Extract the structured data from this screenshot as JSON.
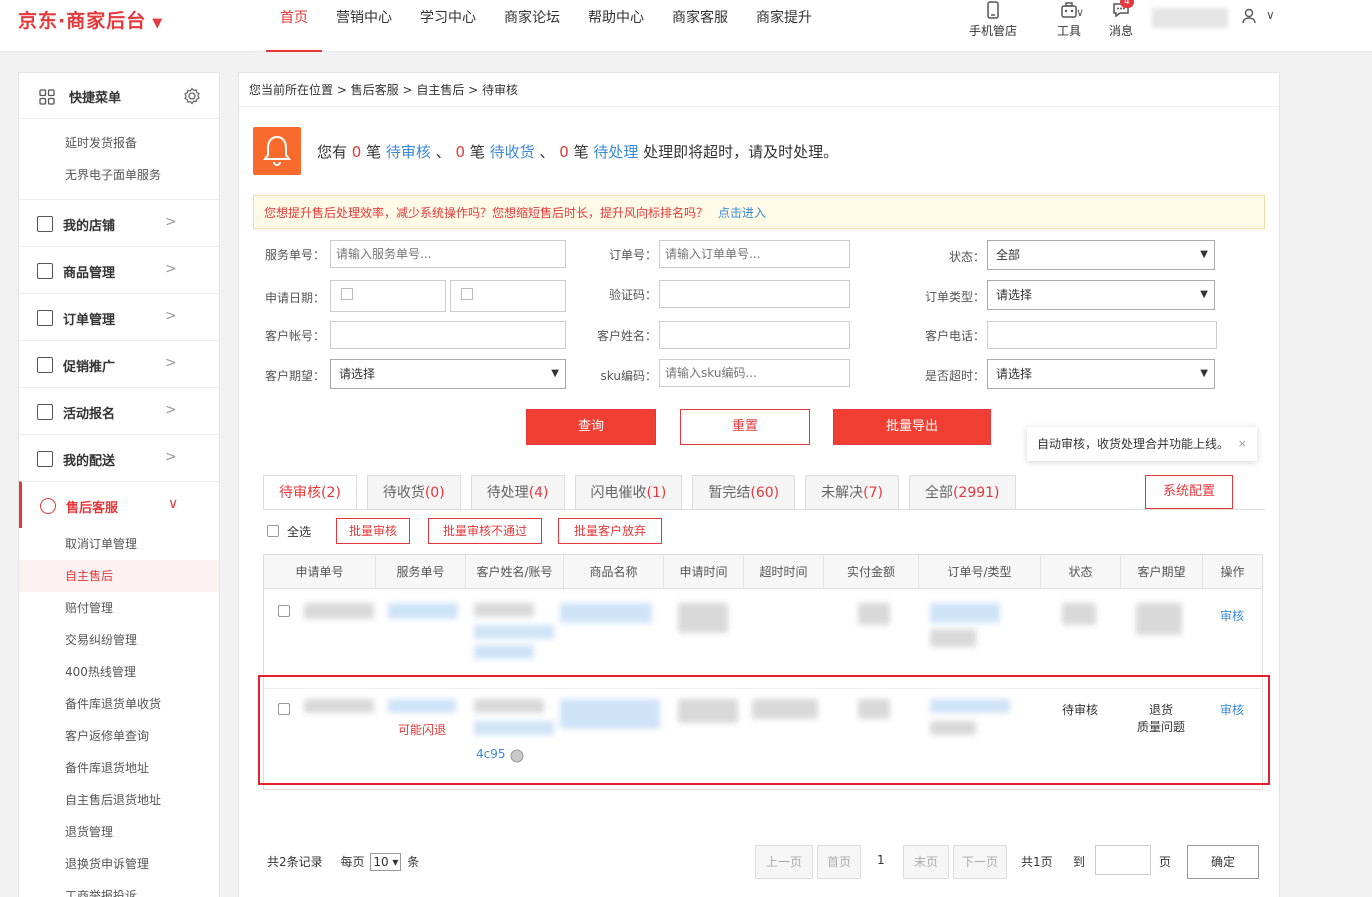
{
  "header": {
    "logo": "京东·商家后台",
    "nav": [
      "首页",
      "营销中心",
      "学习中心",
      "商家论坛",
      "帮助中心",
      "商家客服",
      "商家提升"
    ],
    "tools": {
      "mobile": "手机管店",
      "tools": "工具",
      "messages": "消息",
      "msg_badge": "4"
    }
  },
  "sidebar": {
    "quick_title": "快捷菜单",
    "quick_items": [
      "延时发货报备",
      "无界电子面单服务"
    ],
    "sections": [
      "我的店铺",
      "商品管理",
      "订单管理",
      "促销推广",
      "活动报名",
      "我的配送"
    ],
    "active_section": "售后客服",
    "sub_items": [
      "取消订单管理",
      "自主售后",
      "赔付管理",
      "交易纠纷管理",
      "400热线管理",
      "备件库退货单收货",
      "客户返修单查询",
      "备件库退货地址",
      "自主售后退货地址",
      "退货管理",
      "退换货申诉管理",
      "工商举报投诉"
    ]
  },
  "breadcrumb": "您当前所在位置 > 售后客服 > 自主售后 > 待审核",
  "alert": {
    "pre": "您有",
    "n1": "0",
    "u1": "笔",
    "l1": "待审核",
    "sep1": "、",
    "n2": "0",
    "u2": "笔",
    "l2": "待收货",
    "sep2": "、",
    "n3": "0",
    "u3": "笔",
    "l3": "待处理",
    "post": "处理即将超时，请及时处理。"
  },
  "notice": {
    "text": "您想提升售后处理效率，减少系统操作吗？您想缩短售后时长，提升风向标排名吗？",
    "link": "点击进入"
  },
  "form": {
    "service_no": "服务单号：",
    "service_no_ph": "请输入服务单号...",
    "order_no": "订单号：",
    "order_no_ph": "请输入订单单号...",
    "status": "状态：",
    "status_val": "全部",
    "apply_date": "申请日期：",
    "verify_code": "验证码：",
    "order_type": "订单类型：",
    "order_type_val": "请选择",
    "cust_account": "客户帐号：",
    "cust_name": "客户姓名：",
    "cust_phone": "客户电话：",
    "cust_expect": "客户期望：",
    "cust_expect_val": "请选择",
    "sku": "sku编码：",
    "sku_ph": "请输入sku编码...",
    "overtime": "是否超时：",
    "overtime_val": "请选择"
  },
  "buttons": {
    "query": "查询",
    "reset": "重置",
    "export": "批量导出",
    "system": "系统配置"
  },
  "tip": {
    "text": "自动审核，收货处理合并功能上线。",
    "close": "×"
  },
  "tabs": [
    {
      "label": "待审核",
      "count": "(2)"
    },
    {
      "label": "待收货",
      "count": "(0)"
    },
    {
      "label": "待处理",
      "count": "(4)"
    },
    {
      "label": "闪电催收",
      "count": "(1)"
    },
    {
      "label": "暂完结",
      "count": "(60)"
    },
    {
      "label": "未解决",
      "count": "(7)"
    },
    {
      "label": "全部",
      "count": "(2991)"
    }
  ],
  "batch": {
    "select_all": "全选",
    "approve": "批量审核",
    "reject": "批量审核不通过",
    "abandon": "批量客户放弃"
  },
  "table": {
    "headers": [
      "申请单号",
      "服务单号",
      "客户姓名/账号",
      "商品名称",
      "申请时间",
      "超时时间",
      "实付金额",
      "订单号/类型",
      "状态",
      "客户期望",
      "操作"
    ],
    "row1": {
      "action": "审核"
    },
    "row2": {
      "flash": "可能闪退",
      "account_tail": "4c95",
      "status": "待审核",
      "expect1": "退货",
      "expect2": "质量问题",
      "action": "审核"
    }
  },
  "pager": {
    "total": "共2条记录",
    "per_page": "每页",
    "per_val": "10",
    "unit": "条",
    "prev": "上一页",
    "first": "首页",
    "current": "1",
    "last": "末页",
    "next": "下一页",
    "pages": "共1页",
    "goto": "到",
    "page": "页",
    "confirm": "确定"
  }
}
